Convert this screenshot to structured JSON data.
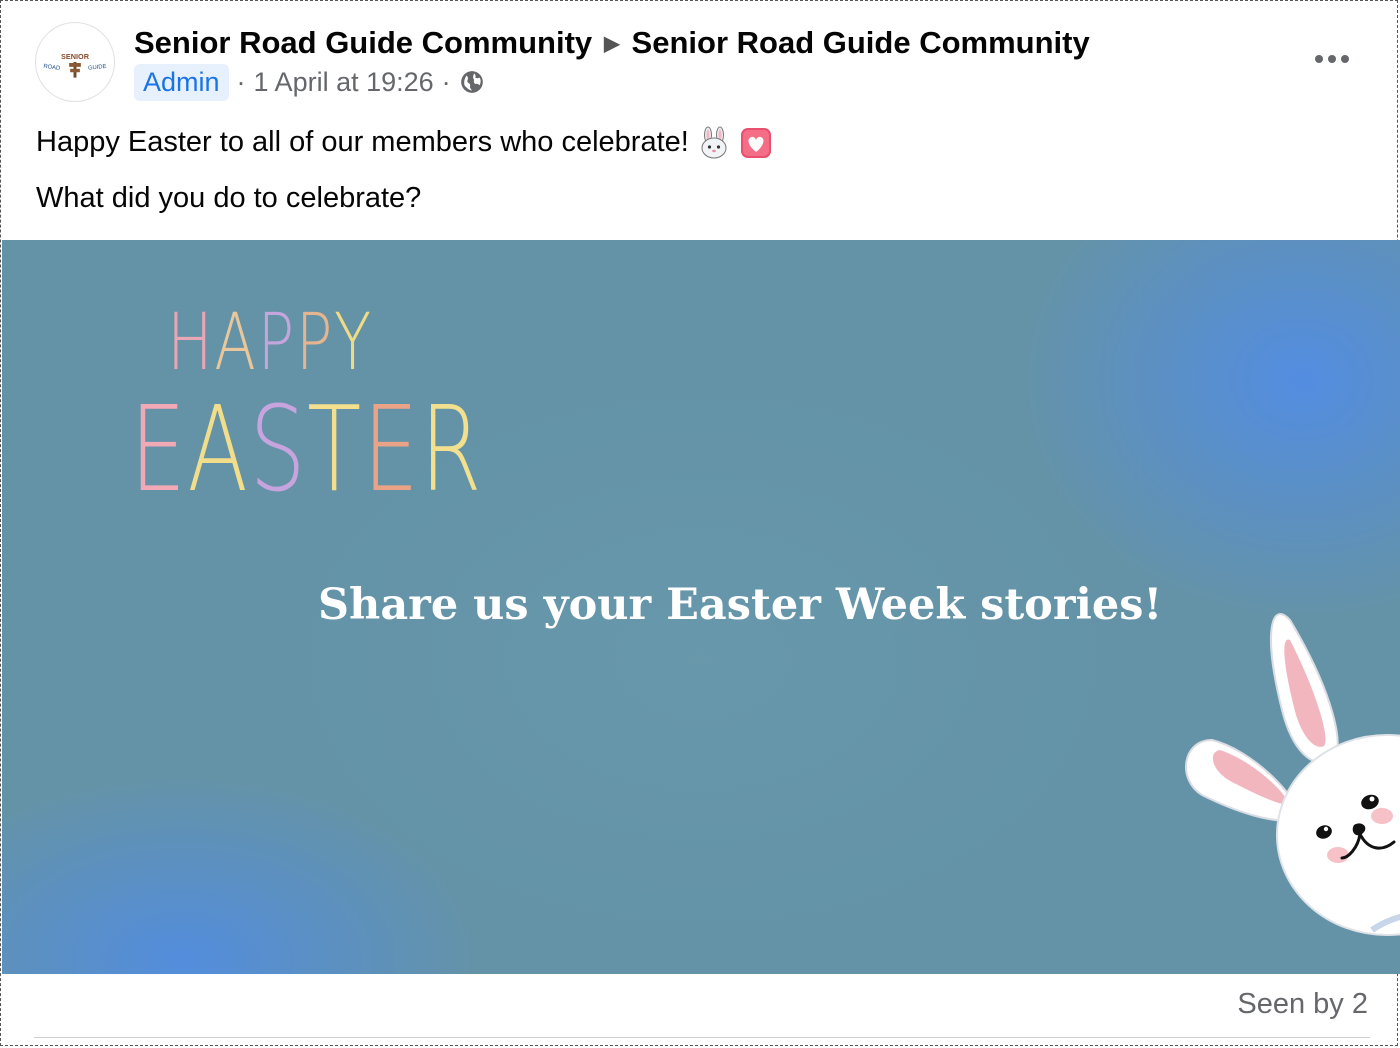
{
  "header": {
    "group_name": "Senior Road Guide Community",
    "target_name": "Senior Road Guide Community",
    "role_badge": "Admin",
    "separator": "·",
    "timestamp": "1 April at 19:26",
    "audience_icon": "globe-icon",
    "more_icon": "more-options-icon"
  },
  "avatar": {
    "logo_text_top": "SENIOR",
    "logo_text_left": "ROAD",
    "logo_text_right": "GUIDE"
  },
  "post": {
    "line1": "Happy Easter to all of our members who celebrate!",
    "line1_emojis": [
      "rabbit-face-emoji",
      "heart-decoration-emoji"
    ],
    "line2": "What did you do to celebrate?"
  },
  "image": {
    "happy_letters": [
      {
        "ch": "H",
        "color": "#e8a7b4"
      },
      {
        "ch": "A",
        "color": "#e9c79a"
      },
      {
        "ch": "P",
        "color": "#c4a6dc"
      },
      {
        "ch": "P",
        "color": "#e6b48f"
      },
      {
        "ch": "Y",
        "color": "#f0db85"
      }
    ],
    "easter_letters": [
      {
        "ch": "E",
        "color": "#f0a9b5"
      },
      {
        "ch": "A",
        "color": "#f2dd8a"
      },
      {
        "ch": "S",
        "color": "#c8a4de"
      },
      {
        "ch": "T",
        "color": "#f3df8d"
      },
      {
        "ch": "E",
        "color": "#eaa386"
      },
      {
        "ch": "R",
        "color": "#f2e08e"
      }
    ],
    "tagline": "Share us your Easter Week stories!",
    "bunny_icon": "easter-bunny-illustration"
  },
  "footer": {
    "seen_by": "Seen by 2"
  }
}
